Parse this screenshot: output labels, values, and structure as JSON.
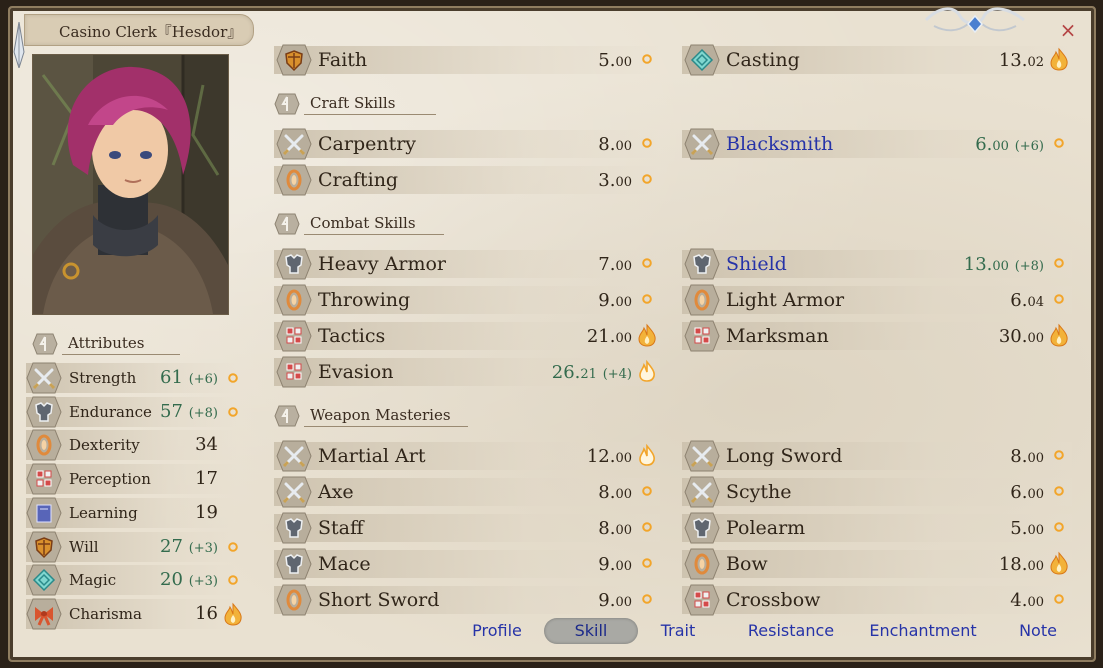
{
  "title": "Casino Clerk『Hesdor』",
  "close_label": "×",
  "attributes": {
    "header": "Attributes",
    "items": [
      {
        "icon": "sword-icon",
        "label": "Strength",
        "value": "61",
        "bonus": "(+6)",
        "potential": "small",
        "green": true
      },
      {
        "icon": "armor-icon",
        "label": "Endurance",
        "value": "57",
        "bonus": "(+8)",
        "potential": "small",
        "green": true
      },
      {
        "icon": "ring-icon",
        "label": "Dexterity",
        "value": "34",
        "bonus": "",
        "potential": "none",
        "green": false
      },
      {
        "icon": "dots-icon",
        "label": "Perception",
        "value": "17",
        "bonus": "",
        "potential": "none",
        "green": false
      },
      {
        "icon": "book-icon",
        "label": "Learning",
        "value": "19",
        "bonus": "",
        "potential": "none",
        "green": false
      },
      {
        "icon": "shield-icon",
        "label": "Will",
        "value": "27",
        "bonus": "(+3)",
        "potential": "small",
        "green": true
      },
      {
        "icon": "rune-icon",
        "label": "Magic",
        "value": "20",
        "bonus": "(+3)",
        "potential": "small",
        "green": true
      },
      {
        "icon": "bow-ribbon-icon",
        "label": "Charisma",
        "value": "16",
        "bonus": "",
        "potential": "flame",
        "green": false
      }
    ]
  },
  "skills": {
    "top_rows": [
      {
        "icon": "shield-icon",
        "label": "Faith",
        "int": "5.",
        "dec": "00",
        "bonus": "",
        "potential": "small",
        "blue": false,
        "green": false
      },
      {
        "icon": "rune-icon",
        "label": "Casting",
        "int": "13.",
        "dec": "02",
        "bonus": "",
        "potential": "flame",
        "blue": false,
        "green": false
      }
    ],
    "sections": [
      {
        "title": "Craft Skills",
        "rows": [
          {
            "icon": "sword-icon",
            "label": "Carpentry",
            "int": "8.",
            "dec": "00",
            "bonus": "",
            "potential": "small",
            "blue": false,
            "green": false
          },
          {
            "icon": "sword-icon",
            "label": "Blacksmith",
            "int": "6.",
            "dec": "00",
            "bonus": "(+6)",
            "potential": "small",
            "blue": true,
            "green": true
          },
          {
            "icon": "ring-icon",
            "label": "Crafting",
            "int": "3.",
            "dec": "00",
            "bonus": "",
            "potential": "small",
            "blue": false,
            "green": false
          }
        ]
      },
      {
        "title": "Combat Skills",
        "rows": [
          {
            "icon": "armor-icon",
            "label": "Heavy Armor",
            "int": "7.",
            "dec": "00",
            "bonus": "",
            "potential": "small",
            "blue": false,
            "green": false
          },
          {
            "icon": "armor-icon",
            "label": "Shield",
            "int": "13.",
            "dec": "00",
            "bonus": "(+8)",
            "potential": "small",
            "blue": true,
            "green": true
          },
          {
            "icon": "ring-icon",
            "label": "Throwing",
            "int": "9.",
            "dec": "00",
            "bonus": "",
            "potential": "small",
            "blue": false,
            "green": false
          },
          {
            "icon": "ring-icon",
            "label": "Light Armor",
            "int": "6.",
            "dec": "04",
            "bonus": "",
            "potential": "small",
            "blue": false,
            "green": false
          },
          {
            "icon": "dots-icon",
            "label": "Tactics",
            "int": "21.",
            "dec": "00",
            "bonus": "",
            "potential": "flame",
            "blue": false,
            "green": false
          },
          {
            "icon": "dots-icon",
            "label": "Marksman",
            "int": "30.",
            "dec": "00",
            "bonus": "",
            "potential": "flame",
            "blue": false,
            "green": false
          },
          {
            "icon": "dots-icon",
            "label": "Evasion",
            "int": "26.",
            "dec": "21",
            "bonus": "(+4)",
            "potential": "flame-outline",
            "blue": false,
            "green": true
          }
        ]
      },
      {
        "title": "Weapon Masteries",
        "rows": [
          {
            "icon": "sword-icon",
            "label": "Martial Art",
            "int": "12.",
            "dec": "00",
            "bonus": "",
            "potential": "flame-outline",
            "blue": false,
            "green": false
          },
          {
            "icon": "sword-icon",
            "label": "Long Sword",
            "int": "8.",
            "dec": "00",
            "bonus": "",
            "potential": "small",
            "blue": false,
            "green": false
          },
          {
            "icon": "sword-icon",
            "label": "Axe",
            "int": "8.",
            "dec": "00",
            "bonus": "",
            "potential": "small",
            "blue": false,
            "green": false
          },
          {
            "icon": "sword-icon",
            "label": "Scythe",
            "int": "6.",
            "dec": "00",
            "bonus": "",
            "potential": "small",
            "blue": false,
            "green": false
          },
          {
            "icon": "armor-icon",
            "label": "Staff",
            "int": "8.",
            "dec": "00",
            "bonus": "",
            "potential": "small",
            "blue": false,
            "green": false
          },
          {
            "icon": "armor-icon",
            "label": "Polearm",
            "int": "5.",
            "dec": "00",
            "bonus": "",
            "potential": "small",
            "blue": false,
            "green": false
          },
          {
            "icon": "armor-icon",
            "label": "Mace",
            "int": "9.",
            "dec": "00",
            "bonus": "",
            "potential": "small",
            "blue": false,
            "green": false
          },
          {
            "icon": "ring-icon",
            "label": "Bow",
            "int": "18.",
            "dec": "00",
            "bonus": "",
            "potential": "flame",
            "blue": false,
            "green": false
          },
          {
            "icon": "ring-icon",
            "label": "Short Sword",
            "int": "9.",
            "dec": "00",
            "bonus": "",
            "potential": "small",
            "blue": false,
            "green": false
          },
          {
            "icon": "dots-icon",
            "label": "Crossbow",
            "int": "4.",
            "dec": "00",
            "bonus": "",
            "potential": "small",
            "blue": false,
            "green": false
          }
        ]
      }
    ]
  },
  "tabs": [
    {
      "label": "Profile",
      "active": false
    },
    {
      "label": "Skill",
      "active": true
    },
    {
      "label": "Trait",
      "active": false
    },
    {
      "label": "Resistance",
      "active": false
    },
    {
      "label": "Enchantment",
      "active": false
    },
    {
      "label": "Note",
      "active": false
    }
  ],
  "colors": {
    "value_green": "#336b4d",
    "skill_blue": "#2633a8",
    "parchment": "#e9e1d1",
    "flame": "#f2a52a"
  }
}
